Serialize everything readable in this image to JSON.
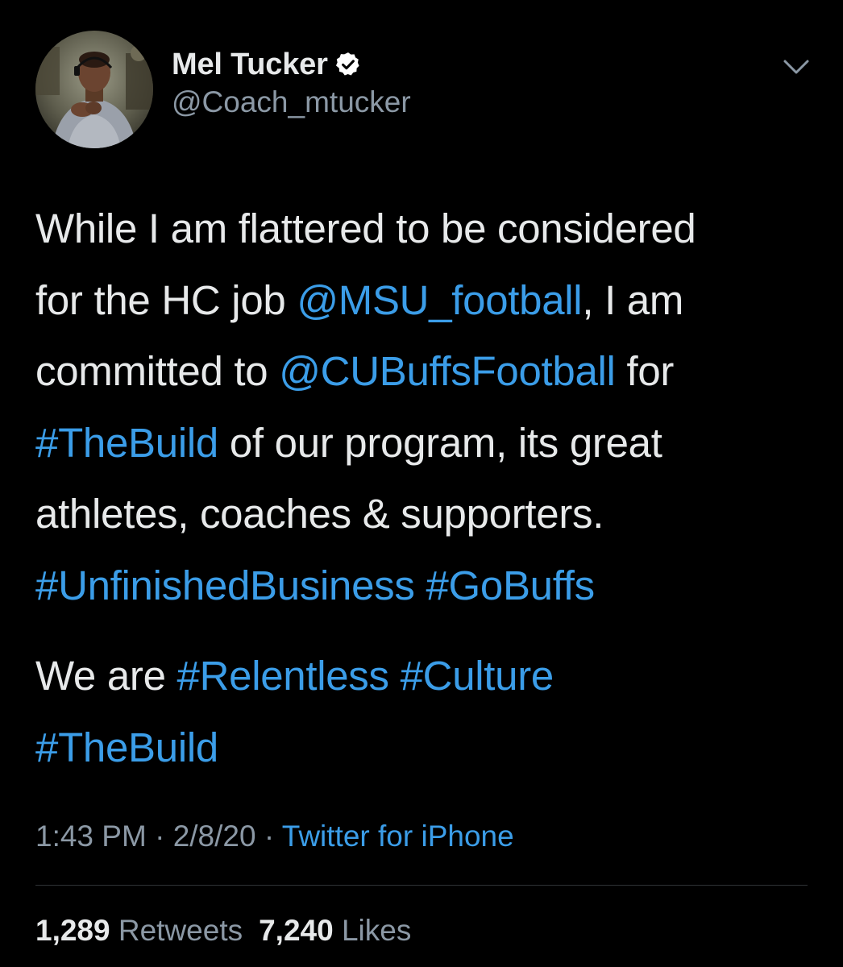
{
  "user": {
    "display_name": "Mel Tucker",
    "handle": "@Coach_mtucker",
    "verified_icon": "verified-badge-icon",
    "avatar_icon": "profile-photo"
  },
  "menu": {
    "icon": "chevron-down-icon"
  },
  "tweet": {
    "line1": "While I am flattered to be considered",
    "line2_pre": "for the HC job ",
    "line2_link": "@MSU_football",
    "line2_post": ", I am",
    "line3_pre": "committed to ",
    "line3_link": "@CUBuffsFootball",
    "line3_post": " for",
    "line4_link": "#TheBuild",
    "line4_post": " of our program, its great",
    "line5": "athletes, coaches & supporters.",
    "line6_link1": "#UnfinishedBusiness",
    "line6_link2": "#GoBuffs",
    "line7_pre": "We are ",
    "line7_link1": "#Relentless",
    "line7_link2": "#Culture",
    "line8_link": "#TheBuild"
  },
  "meta": {
    "time": "1:43 PM",
    "separator": " · ",
    "date": "2/8/20",
    "source": "Twitter for iPhone"
  },
  "stats": {
    "retweets_count": "1,289",
    "retweets_label": "Retweets",
    "likes_count": "7,240",
    "likes_label": "Likes"
  },
  "colors": {
    "background": "#000000",
    "text": "#e7e9ea",
    "secondary": "#8b98a5",
    "link": "#3b9de8",
    "divider": "#2f3336"
  }
}
